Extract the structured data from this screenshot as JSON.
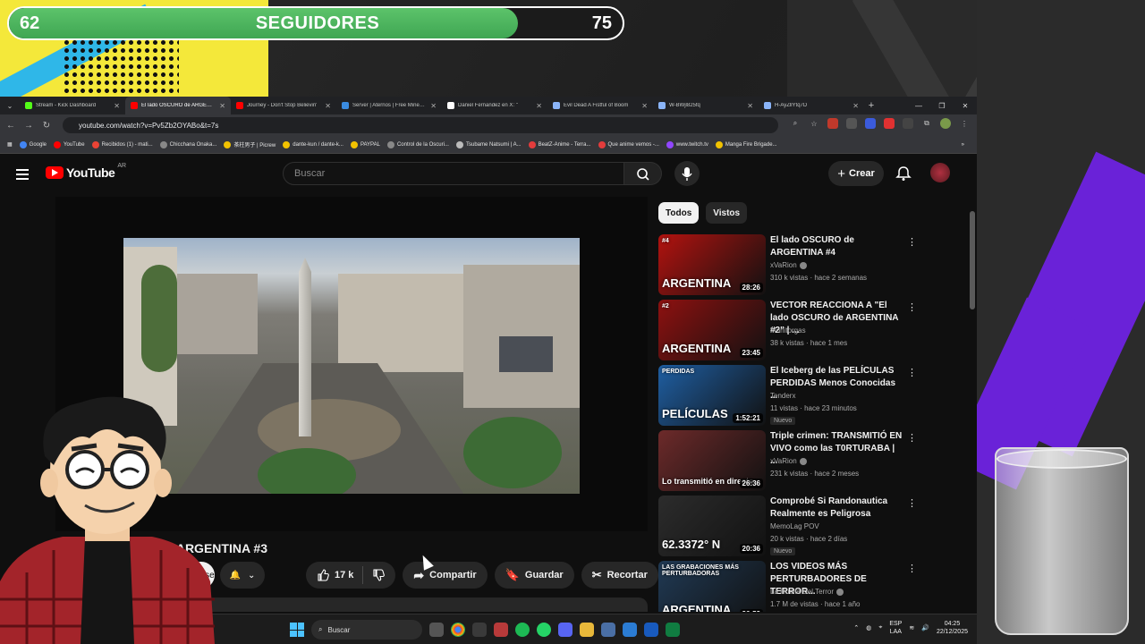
{
  "overlay": {
    "followers": {
      "current": "62",
      "label": "SEGUIDORES",
      "goal": "75",
      "progress_fraction": 0.83
    },
    "colors": {
      "yellow": "#f4e83a",
      "cyan": "#2fb7e8",
      "purple": "#6a22d8",
      "bar_green": "#4cb85e"
    }
  },
  "browser": {
    "tabs": [
      {
        "title": "Stream - Kick Dashboard",
        "icon": "kick-icon",
        "color": "#53fc18"
      },
      {
        "title": "El lado OSCURO de ARGENTINA",
        "icon": "youtube-icon",
        "color": "#ff0000",
        "active": true
      },
      {
        "title": "Journey - Don't Stop Believin'",
        "icon": "youtube-icon",
        "color": "#ff0000"
      },
      {
        "title": "Server | Aternos | Free Minecraft",
        "icon": "aternos-icon",
        "color": "#3a8be0"
      },
      {
        "title": "Daniel Fernandez en X: \"",
        "icon": "x-icon",
        "color": "#ffffff"
      },
      {
        "title": "Evil Dead A Fistful of Boom",
        "icon": "page-icon",
        "color": "#8ab4f8"
      },
      {
        "title": "W-BWjl825fq",
        "icon": "page-icon",
        "color": "#8ab4f8"
      },
      {
        "title": "H-AyZllYtq7D",
        "icon": "page-icon",
        "color": "#8ab4f8"
      }
    ],
    "url": "youtube.com/watch?v=Pv5Zb2OYABo&t=7s",
    "bookmarks": [
      {
        "label": "Google",
        "color": "#4285f4"
      },
      {
        "label": "YouTube",
        "color": "#ff0000"
      },
      {
        "label": "Recibidos (1) - mati...",
        "color": "#ea4335"
      },
      {
        "label": "Chicchana Onaka...",
        "color": "#888888"
      },
      {
        "label": "茶柱男子 | Picrew",
        "color": "#f2c200"
      },
      {
        "label": "dante-kun / dante-k...",
        "color": "#f2c200"
      },
      {
        "label": "PAYPAL",
        "color": "#f2c200"
      },
      {
        "label": "Control de la Oscuri...",
        "color": "#888888"
      },
      {
        "label": "Tsubame Natsumi | A...",
        "color": "#bbbbbb"
      },
      {
        "label": "BeatZ-Anime - Terra...",
        "color": "#e33c3c"
      },
      {
        "label": "Que anime vemos -...",
        "color": "#e33c3c"
      },
      {
        "label": "www.twitch.tv",
        "color": "#9146ff"
      },
      {
        "label": "Manga Fire Brigade...",
        "color": "#f2c200"
      }
    ]
  },
  "youtube": {
    "logo": "YouTube",
    "country": "AR",
    "search_placeholder": "Buscar",
    "create_label": "Crear",
    "video": {
      "title": "El lado OSCURO de ARGENTINA #3",
      "title_visible": "El lado OSCURO de ARGENTINA #3",
      "subscribe_label": "Suscribirse",
      "likes": "17 k",
      "share_label": "Compartir",
      "save_label": "Guardar",
      "clip_label": "Recortar"
    },
    "chips": [
      "Todos",
      "Vistos"
    ],
    "recommendations": [
      {
        "title": "El lado OSCURO de ARGENTINA #4",
        "channel": "xVaRion",
        "verified": true,
        "meta": "310 k vistas · hace 2 semanas",
        "duration": "28:26",
        "thumb_text": "ARGENTINA",
        "thumb_tag": "#4",
        "thumb_color": "#b3120f",
        "badge": ""
      },
      {
        "title": "VECTOR REACCIONA A \"El lado OSCURO de ARGENTINA #2\" | ...",
        "channel": "Monitorgas",
        "verified": false,
        "meta": "38 k vistas · hace 1 mes",
        "duration": "23:45",
        "thumb_text": "ARGENTINA",
        "thumb_tag": "#2",
        "thumb_color": "#8e1110",
        "badge": ""
      },
      {
        "title": "El Iceberg de las PELÍCULAS PERDIDAS Menos Conocidas ...",
        "channel": "Tenderx",
        "verified": false,
        "meta": "11 vistas · hace 23 minutos",
        "duration": "1:52:21",
        "thumb_text": "PELÍCULAS",
        "thumb_tag": "PERDIDAS",
        "thumb_color": "#1f5fa3",
        "badge": "Nuevo"
      },
      {
        "title": "Triple crimen: TRANSMITIÓ EN VIVO como las T0RTURABA | ...",
        "channel": "xVaRion",
        "verified": true,
        "meta": "231 k vistas · hace 2 meses",
        "duration": "26:36",
        "thumb_text": "Lo transmitió en directo",
        "thumb_tag": "",
        "thumb_color": "#6d2a2a",
        "badge": ""
      },
      {
        "title": "Comprobé Si Randonautica Realmente es Peligrosa",
        "channel": "MemoLag POV",
        "verified": false,
        "meta": "20 k vistas · hace 2 días",
        "duration": "20:36",
        "thumb_text": "62.3372° N",
        "thumb_tag": "",
        "thumb_color": "#2c2c2c",
        "badge": "Nuevo"
      },
      {
        "title": "LOS VIDEOS MÁS PERTURBADORES DE TERROR...",
        "channel": "La Huella Del Terror",
        "verified": true,
        "meta": "1.7 M de vistas · hace 1 año",
        "duration": "36:53",
        "thumb_text": "ARGENTINA",
        "thumb_tag": "LAS GRABACIONES MÁS PERTURBADORAS",
        "thumb_color": "#203a55",
        "badge": ""
      }
    ]
  },
  "taskbar": {
    "search_label": "Buscar",
    "lang_top": "ESP",
    "lang_bottom": "LAA",
    "time": "04:25",
    "date": "22/12/2025"
  }
}
